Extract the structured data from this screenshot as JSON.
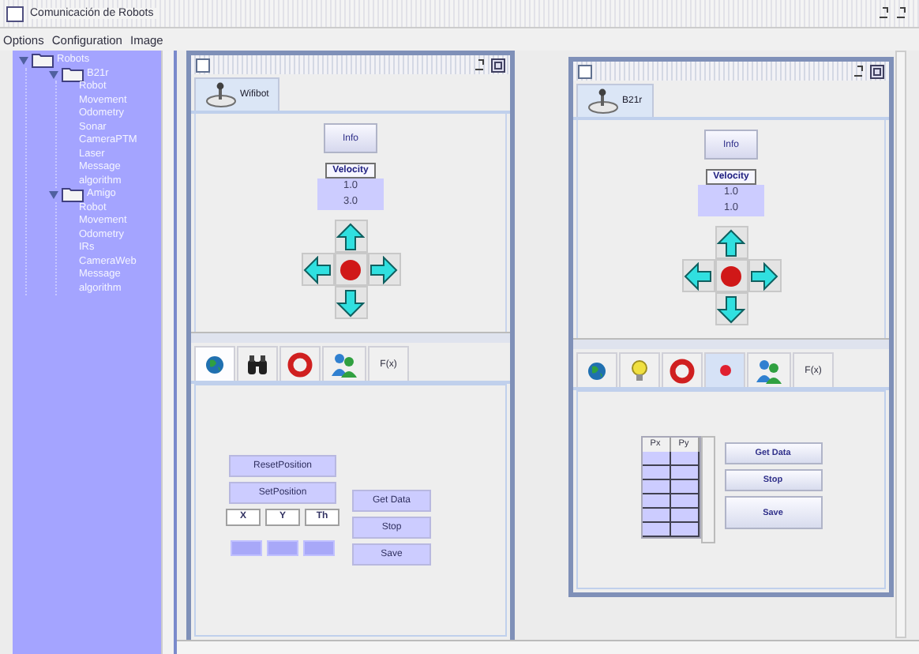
{
  "window": {
    "title": "Comunicación de Robots"
  },
  "menu": [
    "Options",
    "Configuration",
    "Image"
  ],
  "tree": {
    "label": "Robots",
    "expanded": true,
    "children": [
      {
        "label": "B21r",
        "expanded": true,
        "children": [
          {
            "label": "Robot"
          },
          {
            "label": "Movement"
          },
          {
            "label": "Odometry"
          },
          {
            "label": "Sonar"
          },
          {
            "label": "CameraPTM"
          },
          {
            "label": "Laser"
          },
          {
            "label": "Message"
          },
          {
            "label": "algorithm"
          }
        ]
      },
      {
        "label": "Amigo",
        "expanded": true,
        "children": [
          {
            "label": "Robot"
          },
          {
            "label": "Movement"
          },
          {
            "label": "Odometry"
          },
          {
            "label": "IRs"
          },
          {
            "label": "CameraWeb"
          },
          {
            "label": "Message"
          },
          {
            "label": "algorithm"
          }
        ]
      }
    ]
  },
  "robot_windows": [
    {
      "tab": {
        "label": "Wifibot",
        "selected": true
      },
      "action_button": "Info",
      "velocity_label": "Velocity",
      "velocity_values": [
        "1.0",
        "3.0"
      ],
      "panel_tabs": [
        {
          "kind": "globe",
          "selected": true
        },
        {
          "kind": "binoculars",
          "selected": false
        },
        {
          "kind": "lifebuoy",
          "selected": false
        },
        {
          "kind": "people",
          "selected": false
        },
        {
          "kind": "text",
          "label": "F(x)",
          "selected": false
        }
      ],
      "panel": {
        "kind": "position",
        "buttons": [
          "ResetPosition",
          "SetPosition"
        ],
        "coords": [
          "X",
          "Y",
          "Th"
        ],
        "side_buttons": [
          "Get Data",
          "Stop",
          "Save"
        ]
      }
    },
    {
      "tab": {
        "label": "B21r",
        "selected": true
      },
      "action_button": "Info",
      "velocity_label": "Velocity",
      "velocity_values": [
        "1.0",
        "1.0"
      ],
      "panel_tabs": [
        {
          "kind": "globe",
          "selected": false
        },
        {
          "kind": "bulb",
          "selected": false
        },
        {
          "kind": "lifebuoy",
          "selected": false
        },
        {
          "kind": "dot",
          "selected": true
        },
        {
          "kind": "people",
          "selected": false
        },
        {
          "kind": "text",
          "label": "F(x)",
          "selected": false
        }
      ],
      "panel": {
        "kind": "table",
        "columns": [
          "Px",
          "Py"
        ],
        "side_buttons": [
          "Get Data",
          "Stop",
          "Save"
        ]
      }
    }
  ]
}
